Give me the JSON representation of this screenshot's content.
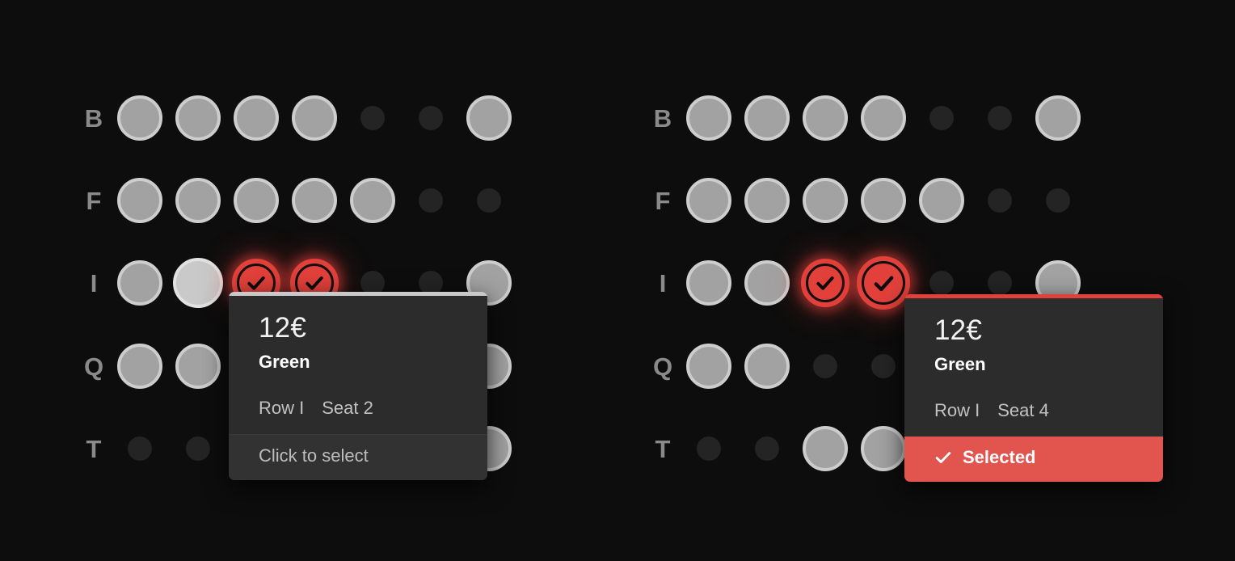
{
  "theme": {
    "background": "#0d0d0d",
    "seat_available": "#a2a2a2",
    "seat_available_border": "#cdcdcd",
    "seat_unavailable": "#242424",
    "seat_selected": "#e2403a",
    "tooltip_bg": "#2c2c2c",
    "tooltip_footer_selected_bg": "#e2544e",
    "row_label_color": "#8a8a8a"
  },
  "panels": [
    {
      "name": "seat-map-hover-state",
      "rows": [
        {
          "label": "B",
          "seats": [
            {
              "state": "available"
            },
            {
              "state": "available"
            },
            {
              "state": "available"
            },
            {
              "state": "available"
            },
            {
              "state": "unavailable"
            },
            {
              "state": "unavailable"
            },
            {
              "state": "available"
            }
          ]
        },
        {
          "label": "F",
          "seats": [
            {
              "state": "available"
            },
            {
              "state": "available"
            },
            {
              "state": "available"
            },
            {
              "state": "available"
            },
            {
              "state": "available"
            },
            {
              "state": "unavailable"
            },
            {
              "state": "unavailable"
            }
          ]
        },
        {
          "label": "I",
          "seats": [
            {
              "state": "available"
            },
            {
              "state": "available",
              "hover": true
            },
            {
              "state": "selected"
            },
            {
              "state": "selected"
            },
            {
              "state": "unavailable"
            },
            {
              "state": "unavailable"
            },
            {
              "state": "available"
            }
          ]
        },
        {
          "label": "Q",
          "seats": [
            {
              "state": "available"
            },
            {
              "state": "available"
            },
            {
              "state": "unavailable"
            },
            {
              "state": "unavailable"
            },
            {
              "state": "unavailable"
            },
            {
              "state": "unavailable"
            },
            {
              "state": "available"
            }
          ]
        },
        {
          "label": "T",
          "seats": [
            {
              "state": "unavailable"
            },
            {
              "state": "unavailable"
            },
            {
              "state": "available"
            },
            {
              "state": "available"
            },
            {
              "state": "unavailable"
            },
            {
              "state": "unavailable"
            },
            {
              "state": "available"
            }
          ]
        }
      ]
    },
    {
      "name": "seat-map-selected-state",
      "rows": [
        {
          "label": "B",
          "seats": [
            {
              "state": "available"
            },
            {
              "state": "available"
            },
            {
              "state": "available"
            },
            {
              "state": "available"
            },
            {
              "state": "unavailable"
            },
            {
              "state": "unavailable"
            },
            {
              "state": "available"
            }
          ]
        },
        {
          "label": "F",
          "seats": [
            {
              "state": "available"
            },
            {
              "state": "available"
            },
            {
              "state": "available"
            },
            {
              "state": "available"
            },
            {
              "state": "available"
            },
            {
              "state": "unavailable"
            },
            {
              "state": "unavailable"
            }
          ]
        },
        {
          "label": "I",
          "seats": [
            {
              "state": "available"
            },
            {
              "state": "available"
            },
            {
              "state": "selected"
            },
            {
              "state": "selected",
              "hover": true
            },
            {
              "state": "unavailable"
            },
            {
              "state": "unavailable"
            },
            {
              "state": "available"
            }
          ]
        },
        {
          "label": "Q",
          "seats": [
            {
              "state": "available"
            },
            {
              "state": "available"
            },
            {
              "state": "unavailable"
            },
            {
              "state": "unavailable"
            },
            {
              "state": "unavailable"
            },
            {
              "state": "unavailable"
            },
            {
              "state": "available"
            }
          ]
        },
        {
          "label": "T",
          "seats": [
            {
              "state": "unavailable"
            },
            {
              "state": "unavailable"
            },
            {
              "state": "available"
            },
            {
              "state": "available"
            },
            {
              "state": "unavailable"
            },
            {
              "state": "unavailable"
            },
            {
              "state": "available"
            }
          ]
        }
      ]
    }
  ],
  "tooltips": {
    "hover": {
      "price": "12€",
      "zone": "Green",
      "row_label": "Row I",
      "seat_label": "Seat 2",
      "action": "Click to select",
      "accent": "#c9c9c9"
    },
    "selected": {
      "price": "12€",
      "zone": "Green",
      "row_label": "Row I",
      "seat_label": "Seat 4",
      "action": "Selected",
      "accent": "#e2403a"
    }
  }
}
